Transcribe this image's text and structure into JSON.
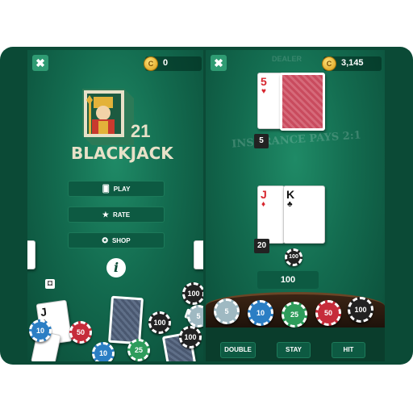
{
  "left_screen": {
    "coins": "0",
    "logo": {
      "number": "21",
      "title": "BLACKJACK"
    },
    "menu": [
      {
        "label": "PLAY",
        "icon": "cards-icon"
      },
      {
        "label": "RATE",
        "icon": "star-icon"
      },
      {
        "label": "SHOP",
        "icon": "chip-icon"
      }
    ],
    "chips": [
      "100",
      "5",
      "10",
      "50",
      "100",
      "10",
      "25",
      "100"
    ],
    "card_rank": "J"
  },
  "right_screen": {
    "coins": "3,145",
    "dealer_label": "DEALER",
    "banner_text": "INSURANCE PAYS 2:1",
    "dealer_card": {
      "rank": "5",
      "suit": "♥"
    },
    "dealer_score": "5",
    "player_cards": [
      {
        "rank": "J",
        "suit": "♦"
      },
      {
        "rank": "K",
        "suit": "♣"
      }
    ],
    "player_score": "20",
    "bet_chip": "100",
    "bet_amount": "100",
    "chip_rack": [
      "5",
      "10",
      "25",
      "50",
      "100"
    ],
    "actions": [
      "DOUBLE",
      "STAY",
      "HIT"
    ]
  },
  "colors": {
    "felt": "#136b4f",
    "felt_dark": "#0b4a36",
    "button": "#0d5a42",
    "coin": "#e8b52a"
  }
}
